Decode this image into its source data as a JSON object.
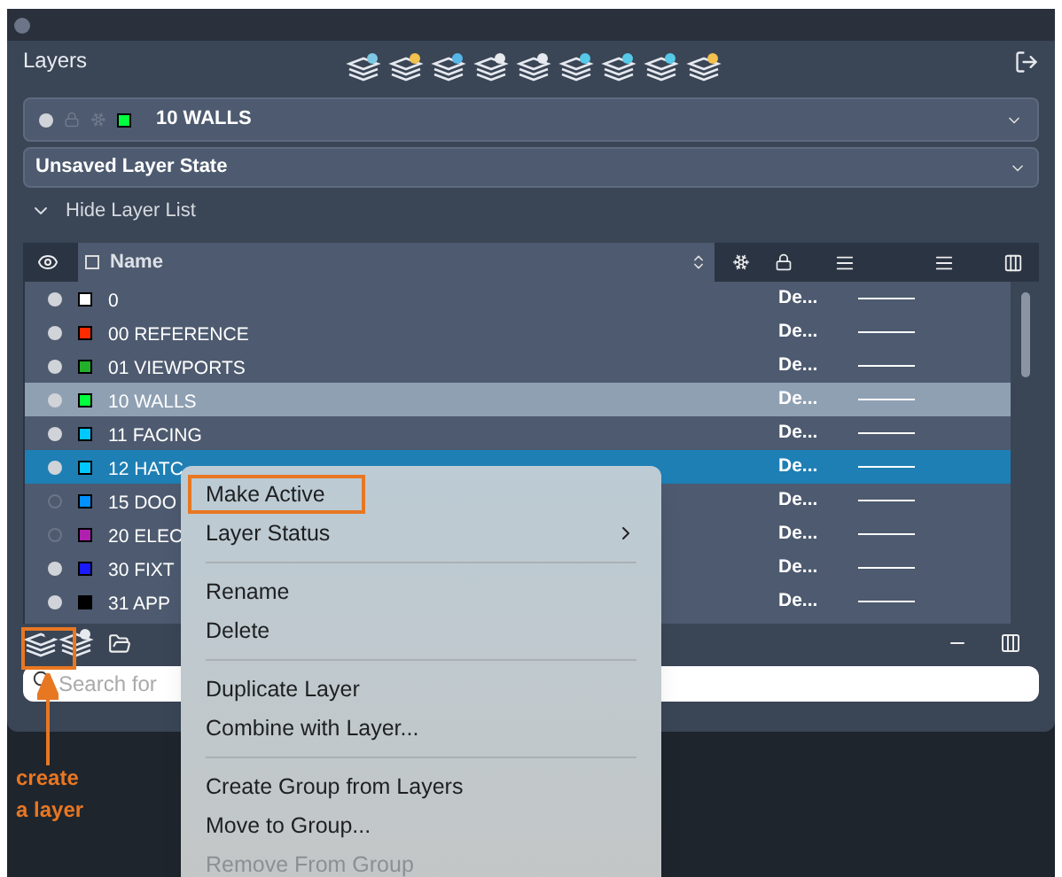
{
  "panel": {
    "title": "Layers"
  },
  "current_layer": {
    "name": "10 WALLS",
    "color": "#00ff3c"
  },
  "layer_state": {
    "value": "Unsaved Layer State"
  },
  "toggle": {
    "label": "Hide Layer List",
    "expanded": true
  },
  "table": {
    "columns": [
      {
        "label": "Name"
      }
    ],
    "rows": [
      {
        "name": "0",
        "on": true,
        "color": "#ffffff",
        "linetype": "De...",
        "current": false,
        "selected": false
      },
      {
        "name": "00 REFERENCE",
        "on": true,
        "color": "#ff2a00",
        "linetype": "De...",
        "current": false,
        "selected": false
      },
      {
        "name": "01 VIEWPORTS",
        "on": true,
        "color": "#22b02a",
        "linetype": "De...",
        "current": false,
        "selected": false
      },
      {
        "name": "10 WALLS",
        "on": true,
        "color": "#00ff3c",
        "linetype": "De...",
        "current": true,
        "selected": false
      },
      {
        "name": "11 FACING",
        "on": true,
        "color": "#00c8ff",
        "linetype": "De...",
        "current": false,
        "selected": false
      },
      {
        "name": "12 HATC",
        "on": true,
        "color": "#00c8ff",
        "linetype": "De...",
        "current": false,
        "selected": true
      },
      {
        "name": "15 DOO",
        "on": false,
        "color": "#0090ff",
        "linetype": "De...",
        "current": false,
        "selected": false
      },
      {
        "name": "20 ELEC",
        "on": false,
        "color": "#b020b0",
        "linetype": "De...",
        "current": false,
        "selected": false
      },
      {
        "name": "30 FIXT",
        "on": true,
        "color": "#1a1aff",
        "linetype": "De...",
        "current": false,
        "selected": false
      },
      {
        "name": "31 APP",
        "on": true,
        "color": "#000000",
        "linetype": "De...",
        "current": false,
        "selected": false
      }
    ]
  },
  "search": {
    "placeholder": "Search for"
  },
  "context_menu": [
    {
      "kind": "item",
      "label": "Make Active",
      "disabled": false,
      "submenu": false
    },
    {
      "kind": "item",
      "label": "Layer Status",
      "disabled": false,
      "submenu": true
    },
    {
      "kind": "separator"
    },
    {
      "kind": "item",
      "label": "Rename",
      "disabled": false,
      "submenu": false
    },
    {
      "kind": "item",
      "label": "Delete",
      "disabled": false,
      "submenu": false
    },
    {
      "kind": "separator"
    },
    {
      "kind": "item",
      "label": "Duplicate Layer",
      "disabled": false,
      "submenu": false
    },
    {
      "kind": "item",
      "label": "Combine with Layer...",
      "disabled": false,
      "submenu": false
    },
    {
      "kind": "separator"
    },
    {
      "kind": "item",
      "label": "Create Group from Layers",
      "disabled": false,
      "submenu": false
    },
    {
      "kind": "item",
      "label": "Move to Group...",
      "disabled": false,
      "submenu": false
    },
    {
      "kind": "item",
      "label": "Remove From Group",
      "disabled": true,
      "submenu": false
    }
  ],
  "annotation": {
    "text": "create\na layer"
  }
}
